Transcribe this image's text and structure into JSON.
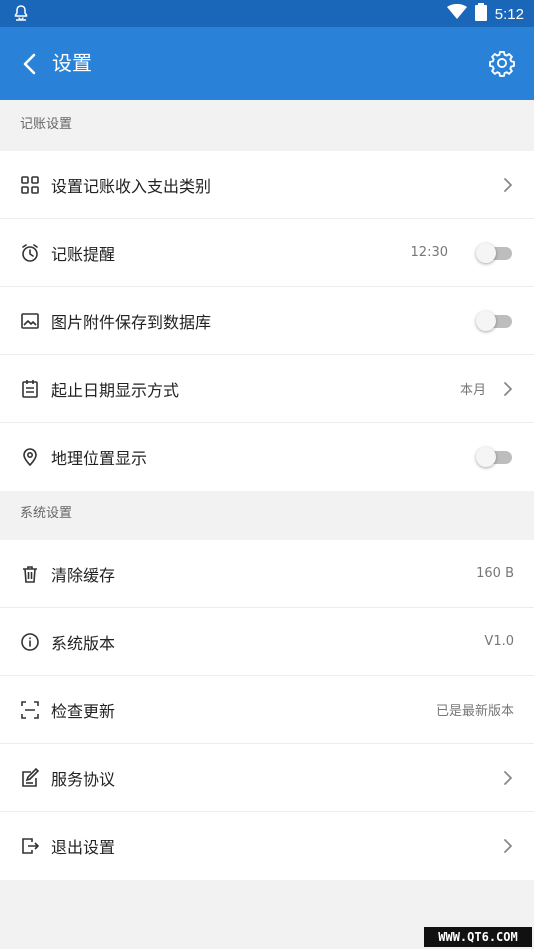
{
  "status_bar": {
    "time": "5:12",
    "icons": [
      "notification-icon",
      "wifi-icon",
      "battery-icon"
    ]
  },
  "app_bar": {
    "title": "设置",
    "back_icon": "back-arrow-icon",
    "settings_icon": "gear-icon",
    "color": "#2a82d8"
  },
  "sections": [
    {
      "header": "记账设置",
      "items": [
        {
          "label": "设置记账收入支出类别",
          "icon": "grid-icon",
          "chevron": true
        },
        {
          "label": "记账提醒",
          "icon": "alarm-icon",
          "value": "12:30",
          "toggle": false
        },
        {
          "label": "图片附件保存到数据库",
          "icon": "image-icon",
          "toggle": false
        },
        {
          "label": "起止日期显示方式",
          "icon": "calendar-icon",
          "value": "本月",
          "chevron": true
        },
        {
          "label": "地理位置显示",
          "icon": "location-icon",
          "toggle": false
        }
      ]
    },
    {
      "header": "系统设置",
      "items": [
        {
          "label": "清除缓存",
          "icon": "trash-icon",
          "value": "160 B"
        },
        {
          "label": "系统版本",
          "icon": "info-icon",
          "value": "V1.0"
        },
        {
          "label": "检查更新",
          "icon": "scan-icon",
          "value": "已是最新版本"
        },
        {
          "label": "服务协议",
          "icon": "edit-document-icon",
          "chevron": true
        },
        {
          "label": "退出设置",
          "icon": "logout-icon",
          "chevron": true
        }
      ]
    }
  ],
  "watermark": "WWW.QT6.COM"
}
